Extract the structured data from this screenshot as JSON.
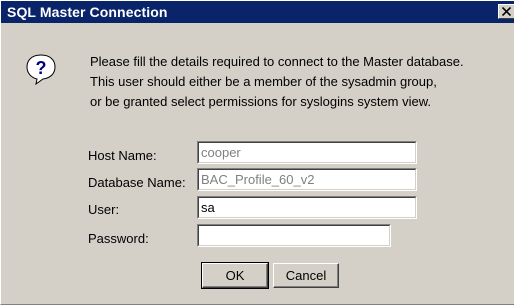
{
  "window": {
    "title": "SQL Master Connection",
    "close_icon": "close-icon"
  },
  "icon": {
    "name": "help-question-icon",
    "glyph": "?"
  },
  "message": {
    "line1": "Please fill the details required to connect to the Master database.",
    "line2": "This user should either be a member of the sysadmin group,",
    "line3": "or be granted select permissions for syslogins system view."
  },
  "form": {
    "host_label": "Host Name:",
    "host_value": "cooper",
    "database_label": "Database Name:",
    "database_value": "BAC_Profile_60_v2",
    "user_label": "User:",
    "user_value": "sa",
    "password_label": "Password:",
    "password_value": ""
  },
  "buttons": {
    "ok_label": "OK",
    "cancel_label": "Cancel"
  },
  "colors": {
    "titlebar": "#0a246a",
    "face": "#d4d0c8",
    "disabled_text": "#808080"
  }
}
